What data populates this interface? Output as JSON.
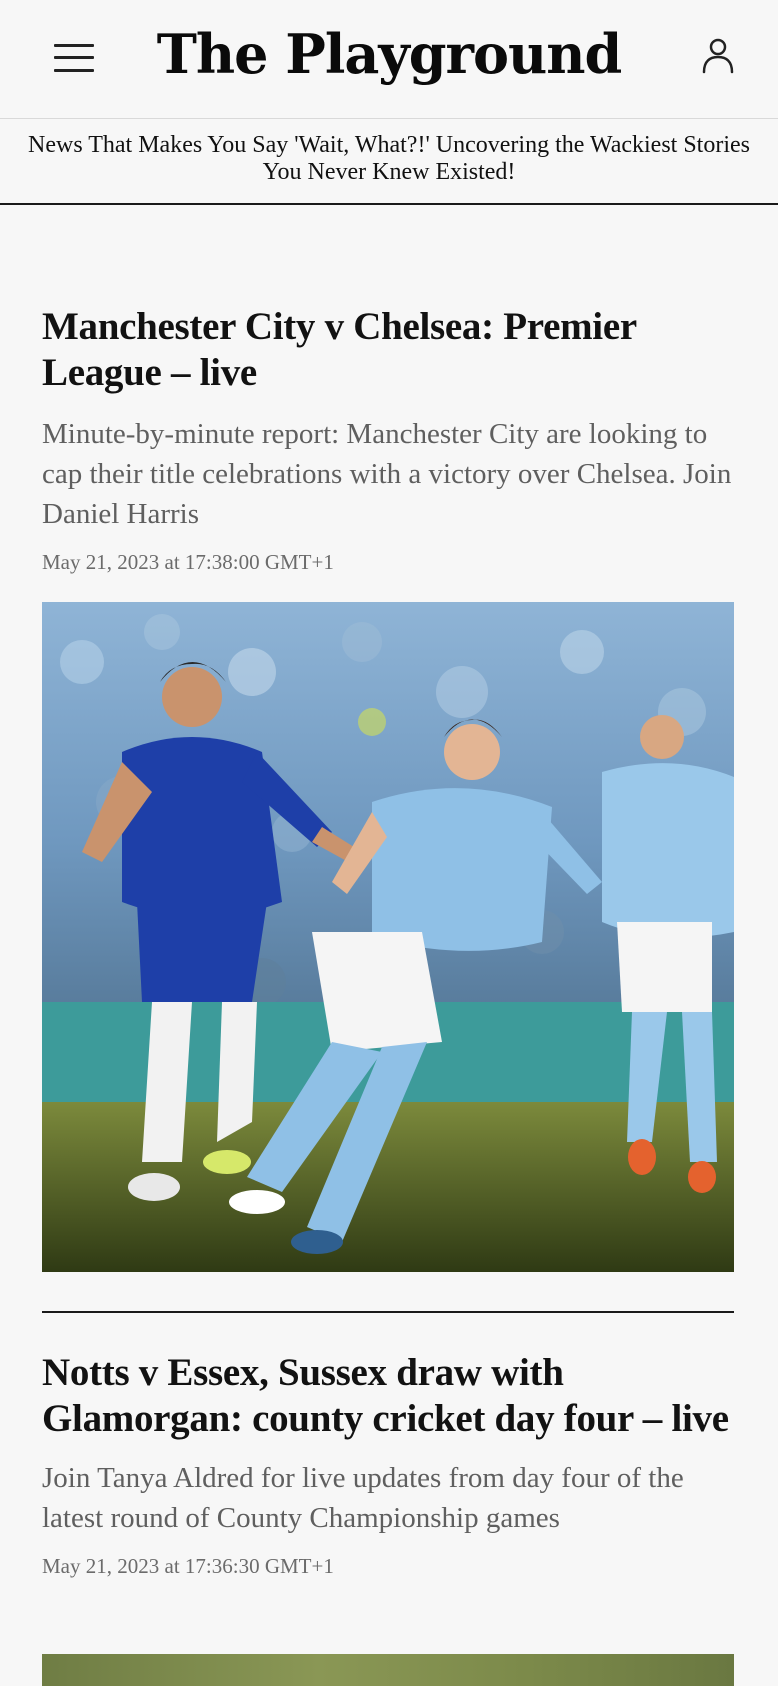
{
  "header": {
    "site_title": "The Playground",
    "menu_icon": "hamburger-menu-icon",
    "account_icon": "user-account-icon",
    "tagline": "News That Makes You Say 'Wait, What?!' Uncovering the Wackiest Stories You Never Knew Existed!"
  },
  "articles": [
    {
      "headline": "Manchester City v Chelsea: Premier League – live",
      "summary": "Minute-by-minute report: Manchester City are looking to cap their title celebrations with a victory over Chelsea. Join Daniel Harris",
      "timestamp": "May 21, 2023 at 17:38:00 GMT+1"
    },
    {
      "headline": "Notts v Essex, Sussex draw with Glamorgan: county cricket day four – live",
      "summary": "Join Tanya Aldred for live updates from day four of the latest round of County Championship games",
      "timestamp": "May 21, 2023 at 17:36:30 GMT+1"
    }
  ],
  "colors": {
    "background": "#f7f7f7",
    "text": "#121212",
    "summary_text": "#5f5f5f",
    "divider": "#1a1a1a"
  }
}
